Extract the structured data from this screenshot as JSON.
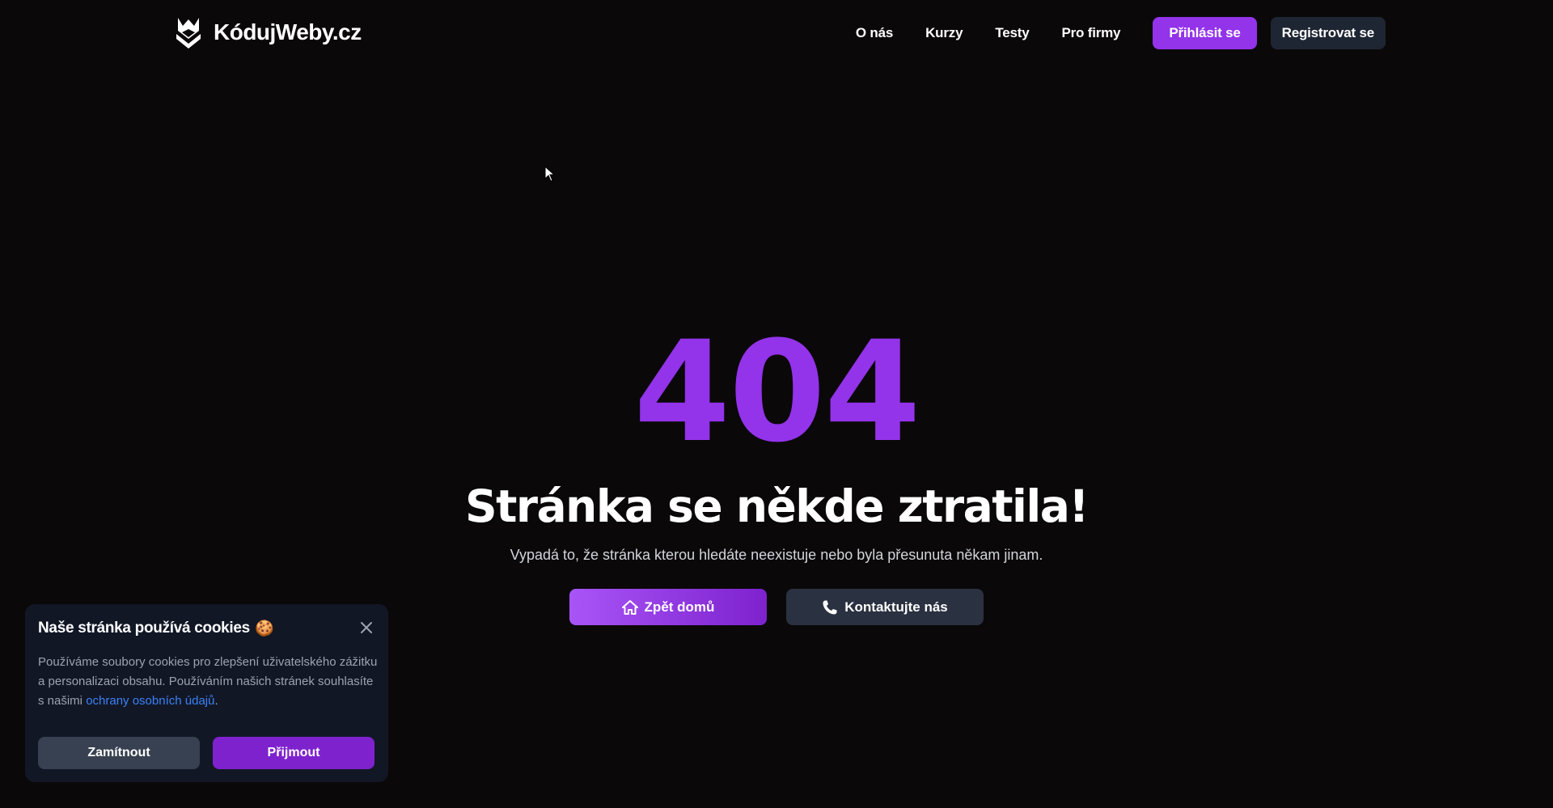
{
  "header": {
    "logo_text": "KódujWeby.cz",
    "nav": [
      "O nás",
      "Kurzy",
      "Testy",
      "Pro firmy"
    ],
    "login_label": "Přihlásit se",
    "register_label": "Registrovat se"
  },
  "hero": {
    "code": "404",
    "title": "Stránka se někde ztratila!",
    "subtitle": "Vypadá to, že stránka kterou hledáte neexistuje nebo byla přesunuta někam jinam.",
    "home_label": "Zpět domů",
    "contact_label": "Kontaktujte nás"
  },
  "cookie": {
    "title": "Naše stránka používá cookies",
    "emoji": "🍪",
    "text_before": "Používáme soubory cookies pro zlepšení uživatelského zážitku a personalizaci obsahu. Používáním našich stránek souhlasíte s našimi ",
    "link": "ochrany osobních údajů",
    "text_after": ".",
    "reject_label": "Zamítnout",
    "accept_label": "Přijmout"
  },
  "colors": {
    "background": "#0b0809",
    "accent": "#9333ea",
    "link": "#3b82f6"
  },
  "icons": [
    "logo-icon",
    "home-icon",
    "phone-icon",
    "close-icon",
    "cursor-icon"
  ]
}
